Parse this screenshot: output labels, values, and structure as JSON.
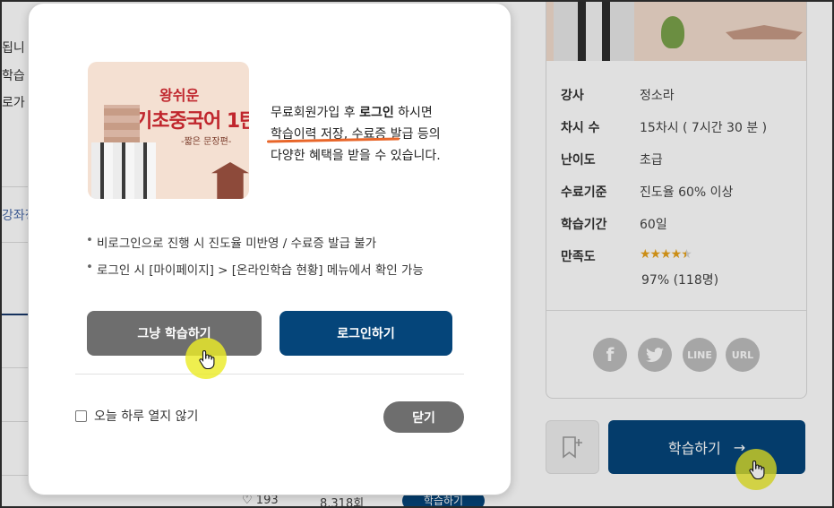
{
  "background": {
    "left_texts": [
      "됩니",
      "학습",
      "로가",
      "강좌정"
    ],
    "course_info": [
      {
        "key": "강사",
        "value": "정소라"
      },
      {
        "key": "차시 수",
        "value": "15차시 ( 7시간 30 분 )"
      },
      {
        "key": "난이도",
        "value": "초급"
      },
      {
        "key": "수료기준",
        "value": "진도율 60% 이상"
      },
      {
        "key": "학습기간",
        "value": "60일"
      },
      {
        "key": "만족도",
        "value": ""
      }
    ],
    "satisfaction": {
      "stars": "★★★★",
      "half_star": "★",
      "rating": 4.5,
      "rating_text": "97% (118명)"
    },
    "social": {
      "facebook": "f",
      "twitter": "t",
      "line": "LINE",
      "url": "URL"
    },
    "study_button": "학습하기",
    "study_arrow": "→",
    "bottom": {
      "likes": "193",
      "views": "8,318회",
      "badge": "학습하기"
    }
  },
  "modal": {
    "thumbnail": {
      "title_top": "왕쉬운",
      "title_main": "기초중국어 1탄",
      "subtitle": "-짧은 문장편-"
    },
    "description": {
      "line1_pre": "무료회원가입 후 ",
      "line1_bold": "로그인",
      "line1_post": " 하시면",
      "line2": "학습이력 저장, 수료증 발급 등의",
      "line3": "다양한 혜택을 받을 수 있습니다."
    },
    "bullets": [
      "비로그인으로 진행 시 진도율 미반영 / 수료증 발급 불가",
      "로그인 시 [마이페이지] > [온라인학습 현황] 메뉴에서 확인 가능"
    ],
    "skip_button": "그냥 학습하기",
    "login_button": "로그인하기",
    "dont_show_today": "오늘 하루 열지 않기",
    "close_button": "닫기"
  },
  "colors": {
    "primary": "#05457a",
    "gray_button": "#6e6e6e",
    "underline": "#e8662a",
    "cursor_highlight": "#ecec28"
  }
}
